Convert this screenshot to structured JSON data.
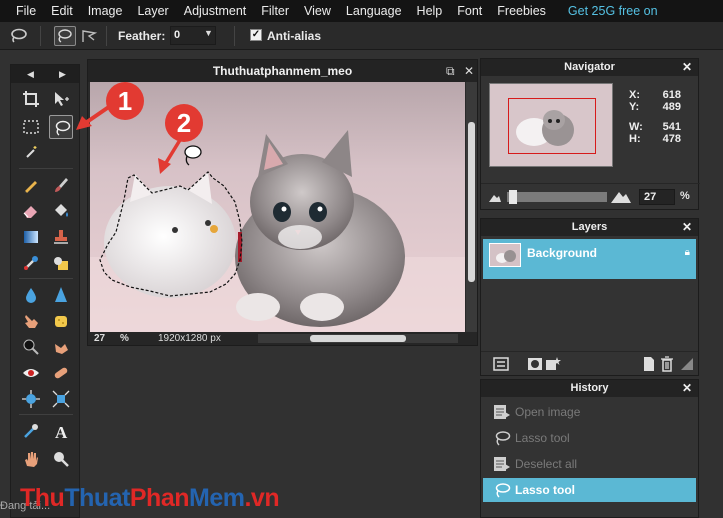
{
  "menu": {
    "items": [
      "File",
      "Edit",
      "Image",
      "Layer",
      "Adjustment",
      "Filter",
      "View",
      "Language",
      "Help",
      "Font",
      "Freebies"
    ],
    "promo": "Get 25G free on"
  },
  "options": {
    "feather_label": "Feather:",
    "feather_value": "0",
    "antialias_label": "Anti-alias",
    "antialias_checked": true
  },
  "toolbox": {
    "left_arrow": "◀",
    "right_arrow": "▶",
    "active_tool": "lasso-tool"
  },
  "document": {
    "title": "Thuthuatphanmem_meo",
    "zoom": "27",
    "zoom_unit": "%",
    "dimensions": "1920x1280 px"
  },
  "navigator": {
    "title": "Navigator",
    "x_label": "X:",
    "x_value": "618",
    "y_label": "Y:",
    "y_value": "489",
    "w_label": "W:",
    "w_value": "541",
    "h_label": "H:",
    "h_value": "478",
    "zoom_value": "27",
    "zoom_unit": "%"
  },
  "layers": {
    "title": "Layers",
    "items": [
      {
        "name": "Background",
        "locked": true
      }
    ]
  },
  "history": {
    "title": "History",
    "items": [
      {
        "label": "Open image",
        "state": "dim",
        "icon": "open-image-icon"
      },
      {
        "label": "Lasso tool",
        "state": "dim",
        "icon": "lasso-icon"
      },
      {
        "label": "Deselect all",
        "state": "dim",
        "icon": "deselect-icon"
      },
      {
        "label": "Lasso tool",
        "state": "selected",
        "icon": "lasso-icon"
      }
    ]
  },
  "annotations": {
    "badge1": "1",
    "badge2": "2"
  },
  "watermark": {
    "p1": "Thu",
    "p2": "Thuat",
    "p3": "Phan",
    "p4": "Mem",
    "p5": ".vn"
  },
  "status_text": "Đang tải..."
}
